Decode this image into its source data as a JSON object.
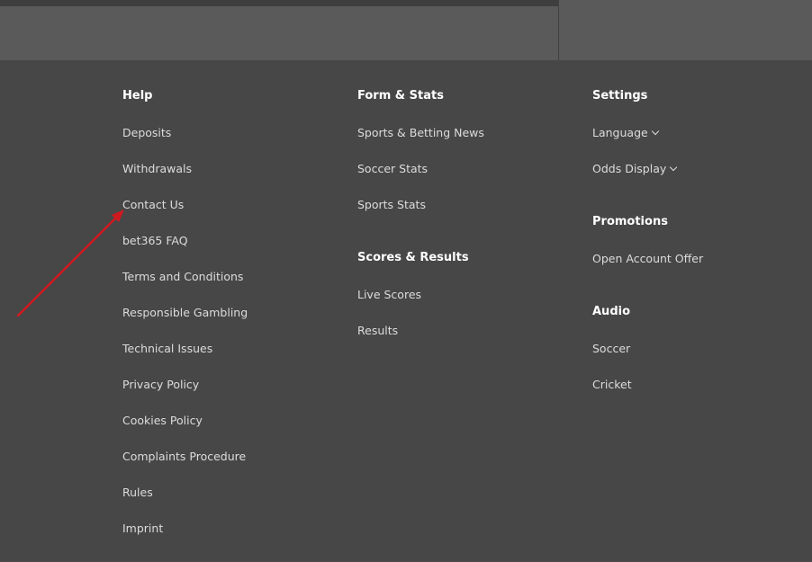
{
  "help": {
    "heading": "Help",
    "links": [
      "Deposits",
      "Withdrawals",
      "Contact Us",
      "bet365 FAQ",
      "Terms and Conditions",
      "Responsible Gambling",
      "Technical Issues",
      "Privacy Policy",
      "Cookies Policy",
      "Complaints Procedure",
      "Rules",
      "Imprint"
    ]
  },
  "form_stats": {
    "heading": "Form & Stats",
    "links": [
      "Sports & Betting News",
      "Soccer Stats",
      "Sports Stats"
    ]
  },
  "scores_results": {
    "heading": "Scores & Results",
    "links": [
      "Live Scores",
      "Results"
    ]
  },
  "settings": {
    "heading": "Settings",
    "language_label": "Language",
    "odds_label": "Odds Display"
  },
  "promotions": {
    "heading": "Promotions",
    "links": [
      "Open Account Offer"
    ]
  },
  "audio": {
    "heading": "Audio",
    "links": [
      "Soccer",
      "Cricket"
    ]
  },
  "colors": {
    "background": "#474747",
    "topbar": "#5a5a5a",
    "annotation_arrow": "#d0191f"
  },
  "icons": [
    "chevron-down-icon",
    "annotation-arrow"
  ]
}
